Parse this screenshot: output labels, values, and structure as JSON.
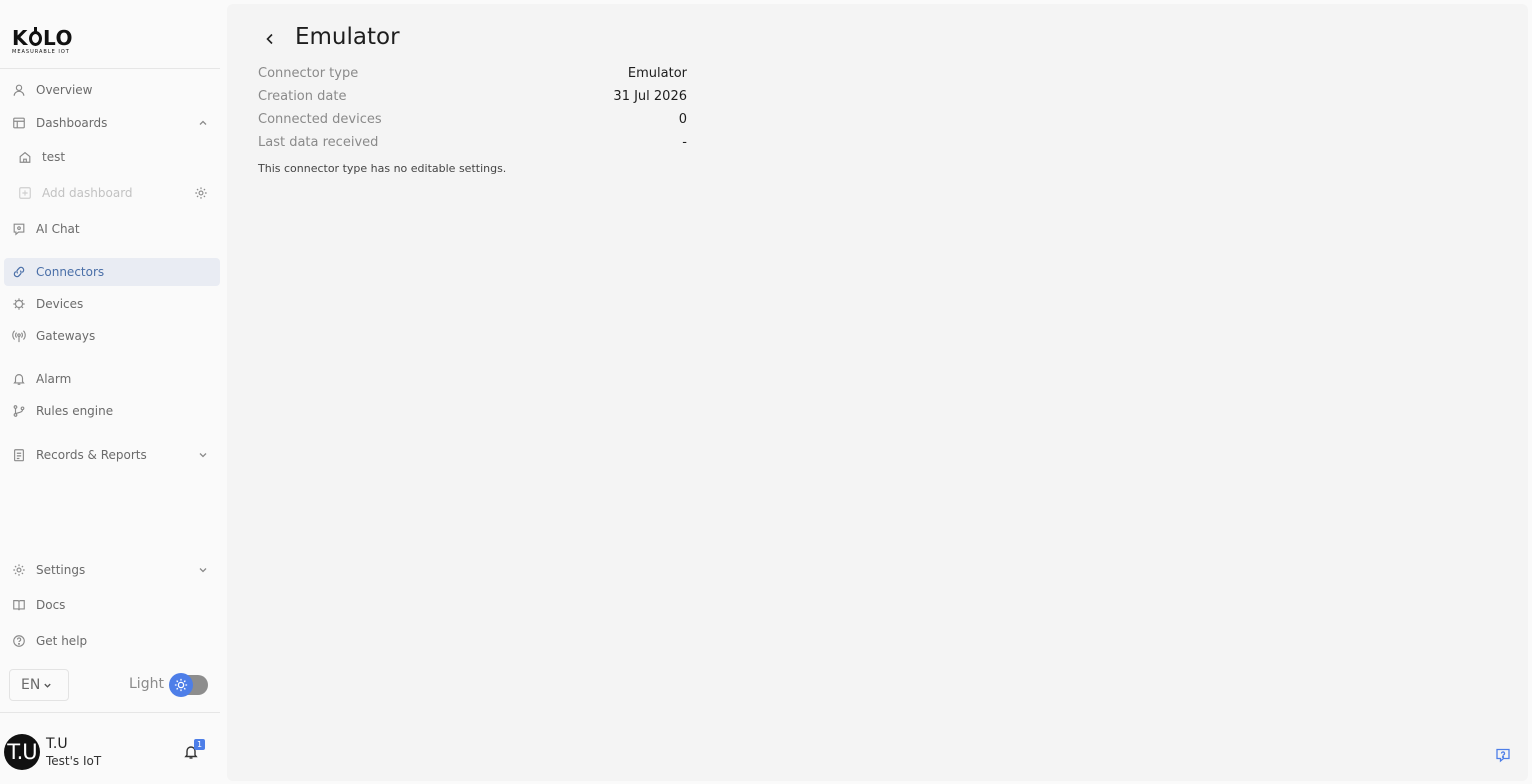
{
  "logo": {
    "word_left": "K",
    "word_right": "LO",
    "tagline": "MEASURABLE IOT"
  },
  "sidebar": {
    "overview": "Overview",
    "dashboards": "Dashboards",
    "dashboard_items": [
      "test"
    ],
    "add_dashboard": "Add dashboard",
    "ai_chat": "AI Chat",
    "connectors": "Connectors",
    "devices": "Devices",
    "gateways": "Gateways",
    "alarm": "Alarm",
    "rules_engine": "Rules engine",
    "records_reports": "Records & Reports",
    "settings": "Settings",
    "docs": "Docs",
    "get_help": "Get help"
  },
  "footer": {
    "language": "EN",
    "theme_label": "Light",
    "user_initials": "T.U",
    "user_name": "T.U",
    "user_org": "Test's IoT",
    "notification_count": "1"
  },
  "main": {
    "title": "Emulator",
    "details": [
      {
        "label": "Connector type",
        "value": "Emulator"
      },
      {
        "label": "Creation date",
        "value": "31 Jul 2026"
      },
      {
        "label": "Connected devices",
        "value": "0"
      },
      {
        "label": "Last data received",
        "value": "-"
      }
    ],
    "note": "This connector type has no editable settings."
  },
  "colors": {
    "accent": "#4d7ee8",
    "active_bg": "#e9ecf3",
    "active_text": "#4a6fa8"
  },
  "icons": {
    "overview": "user-icon",
    "dashboards": "layout-icon",
    "dashboard_item": "home-icon",
    "add_dashboard": "plus-square-icon",
    "ai_chat": "chat-icon",
    "connectors": "link-icon",
    "devices": "chip-icon",
    "gateways": "antenna-icon",
    "alarm": "bell-icon",
    "rules_engine": "branch-icon",
    "records_reports": "clipboard-icon",
    "settings": "gear-icon",
    "docs": "book-icon",
    "get_help": "help-circle-icon"
  }
}
